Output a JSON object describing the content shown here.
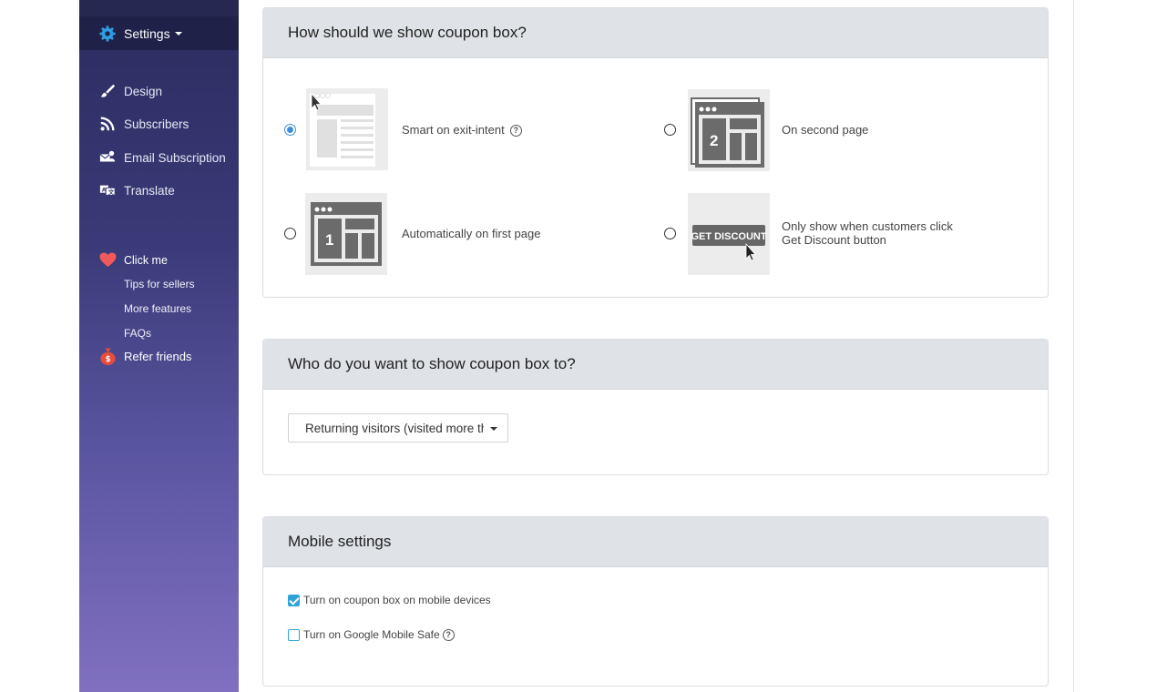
{
  "sidebar": {
    "settings_label": "Settings",
    "items": [
      {
        "label": "Design",
        "icon": "brush-icon"
      },
      {
        "label": "Subscribers",
        "icon": "rss-icon"
      },
      {
        "label": "Email Subscription",
        "icon": "email-subscription-icon"
      },
      {
        "label": "Translate",
        "icon": "translate-icon"
      }
    ],
    "click_me": "Click me",
    "sub_items": [
      "Tips for sellers",
      "More features",
      "FAQs"
    ],
    "refer_friends": "Refer friends"
  },
  "show_panel": {
    "title": "How should we show coupon box?",
    "options": [
      {
        "label": "Smart on exit-intent",
        "selected": true,
        "has_help": true
      },
      {
        "label": "On second page",
        "selected": false,
        "thumb_number": "2"
      },
      {
        "label": "Automatically on first page",
        "selected": false,
        "thumb_number": "1"
      },
      {
        "label_line1": "Only show when customers click",
        "label_line2": "Get Discount button",
        "selected": false,
        "thumb_text": "GET DISCOUNT"
      }
    ]
  },
  "audience_panel": {
    "title": "Who do you want to show coupon box to?",
    "selected_value": "Returning visitors (visited more than once)"
  },
  "mobile_panel": {
    "title": "Mobile settings",
    "checkboxes": [
      {
        "label": "Turn on coupon box on mobile devices",
        "checked": true
      },
      {
        "label": "Turn on Google Mobile Safe",
        "checked": false,
        "has_help": true
      }
    ]
  },
  "colors": {
    "accent": "#3b8fd6",
    "checkbox": "#2fa4d9",
    "sidebar_top": "#2a2c5e",
    "sidebar_bottom": "#8170c0",
    "panel_header": "#dfe2e6"
  }
}
